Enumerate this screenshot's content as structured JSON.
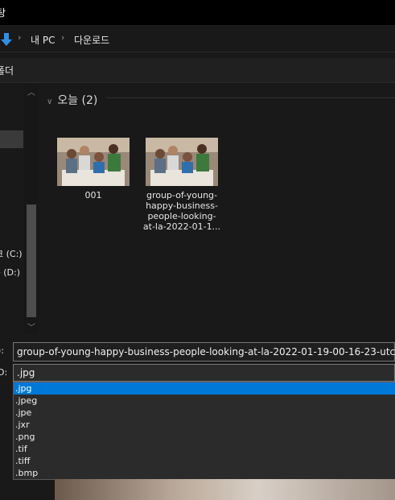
{
  "window": {
    "title": "탕"
  },
  "address_bar": {
    "crumbs": [
      "내 PC",
      "다운로드"
    ],
    "separator": "›"
  },
  "command_bar": {
    "label": "폴더"
  },
  "nav_pane": {
    "drives": [
      "크 (C:)",
      "e (D:)"
    ]
  },
  "main": {
    "group_header": "오늘 (2)",
    "files": [
      {
        "name": "001"
      },
      {
        "name": "group-of-young-happy-business-people-looking-at-la-2022-01-1..."
      }
    ]
  },
  "file_name": {
    "label": "):",
    "value": "group-of-young-happy-business-people-looking-at-la-2022-01-19-00-16-23-utc"
  },
  "file_type": {
    "label": "D:",
    "selected": ".jpg",
    "options": [
      ".jpg",
      ".jpeg",
      ".jpe",
      ".jxr",
      ".png",
      ".tif",
      ".tiff",
      ".bmp"
    ]
  },
  "colors": {
    "accent": "#0078d7",
    "background": "#191919"
  }
}
